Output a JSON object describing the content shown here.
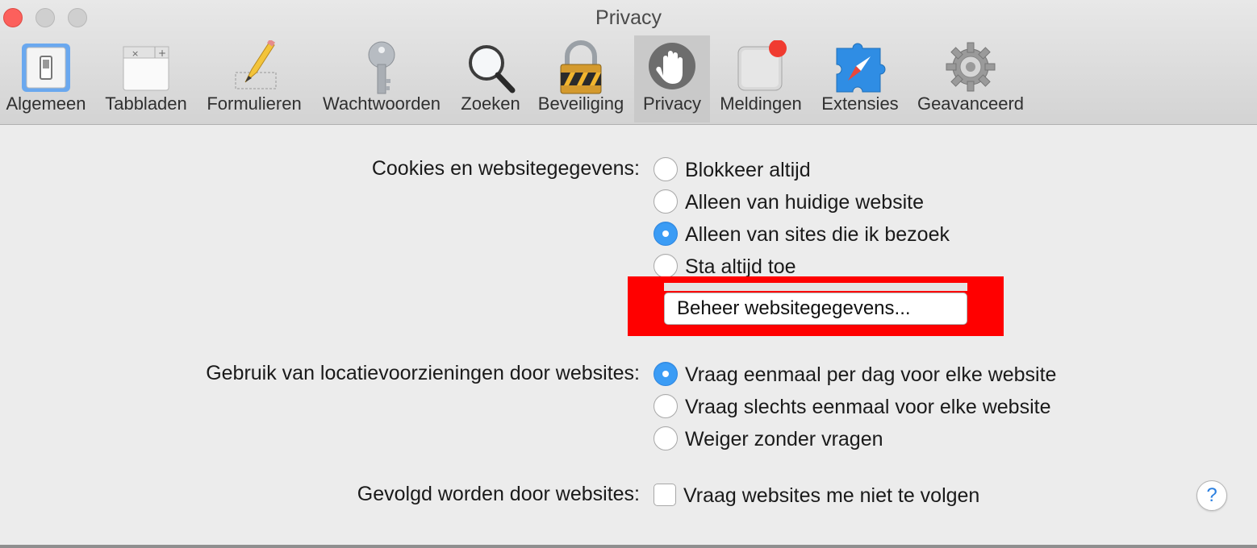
{
  "window": {
    "title": "Privacy"
  },
  "toolbar": {
    "tabs": [
      {
        "label": "Algemeen",
        "icon": "general-switch-icon"
      },
      {
        "label": "Tabbladen",
        "icon": "tabs-icon"
      },
      {
        "label": "Formulieren",
        "icon": "pencil-form-icon"
      },
      {
        "label": "Wachtwoorden",
        "icon": "key-icon"
      },
      {
        "label": "Zoeken",
        "icon": "magnifier-icon"
      },
      {
        "label": "Beveiliging",
        "icon": "padlock-icon"
      },
      {
        "label": "Privacy",
        "icon": "hand-icon",
        "selected": true
      },
      {
        "label": "Meldingen",
        "icon": "notification-icon"
      },
      {
        "label": "Extensies",
        "icon": "puzzle-compass-icon"
      },
      {
        "label": "Geavanceerd",
        "icon": "gear-icon"
      }
    ]
  },
  "cookies": {
    "label": "Cookies en websitegegevens:",
    "options": [
      {
        "text": "Blokkeer altijd",
        "checked": false
      },
      {
        "text": "Alleen van huidige website",
        "checked": false
      },
      {
        "text": "Alleen van sites die ik bezoek",
        "checked": true
      },
      {
        "text": "Sta altijd toe",
        "checked": false
      }
    ],
    "manage_button": "Beheer websitegegevens..."
  },
  "location": {
    "label": "Gebruik van locatievoorzieningen door websites:",
    "options": [
      {
        "text": "Vraag eenmaal per dag voor elke website",
        "checked": true
      },
      {
        "text": "Vraag slechts eenmaal voor elke website",
        "checked": false
      },
      {
        "text": "Weiger zonder vragen",
        "checked": false
      }
    ]
  },
  "tracking": {
    "label": "Gevolgd worden door websites:",
    "checkbox_text": "Vraag websites me niet te volgen",
    "checked": false
  },
  "help": {
    "symbol": "?"
  },
  "colors": {
    "accent": "#3b9cf5",
    "highlight": "#ff0000",
    "close": "#fc605c"
  }
}
